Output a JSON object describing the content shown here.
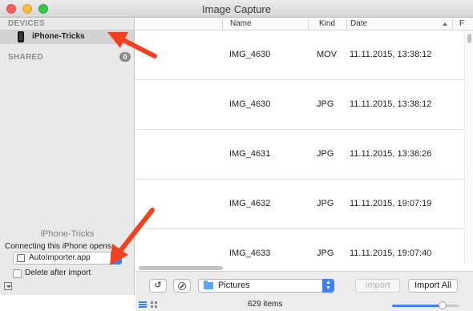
{
  "window": {
    "title": "Image Capture"
  },
  "sidebar": {
    "devices_header": "DEVICES",
    "device_name": "iPhone-Tricks",
    "shared_header": "SHARED",
    "shared_count": "0",
    "device_panel_title": "iPhone-Tricks",
    "connect_label": "Connecting this iPhone opens:",
    "connect_app": "AutoImporter.app",
    "delete_after_import_label": "Delete after import",
    "delete_after_import_checked": false
  },
  "table": {
    "columns": [
      "Name",
      "Kind",
      "Date",
      "F"
    ],
    "rows": [
      {
        "name": "IMG_4630",
        "kind": "MOV",
        "date": "11.11.2015, 13:38:12"
      },
      {
        "name": "IMG_4630",
        "kind": "JPG",
        "date": "11.11.2015, 13:38:12"
      },
      {
        "name": "IMG_4631",
        "kind": "JPG",
        "date": "11.11.2015, 13:38:26"
      },
      {
        "name": "IMG_4632",
        "kind": "JPG",
        "date": "11.11.2015, 19:07:19"
      },
      {
        "name": "IMG_4633",
        "kind": "JPG",
        "date": "11.11.2015, 19:07:40"
      }
    ]
  },
  "toolbar": {
    "rotate_icon": "↺",
    "destination": "Pictures",
    "import_label": "Import",
    "import_all_label": "Import All"
  },
  "status": {
    "item_count": "629 items",
    "thumbnail_size_fraction": 0.75
  },
  "colors": {
    "accent": "#3b82f0",
    "annotation": "#f2411f"
  }
}
